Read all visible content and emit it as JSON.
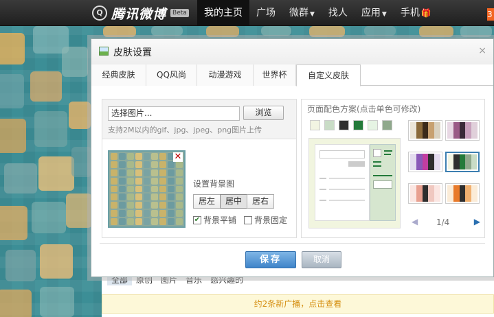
{
  "topbar": {
    "logo_mark": "Q",
    "logo_text": "腾讯微博",
    "beta": "Beta",
    "nav": [
      {
        "label": "我的主页",
        "active": true,
        "caret": false
      },
      {
        "label": "广场",
        "active": false,
        "caret": false
      },
      {
        "label": "微群",
        "active": false,
        "caret": true
      },
      {
        "label": "找人",
        "active": false,
        "caret": false
      },
      {
        "label": "应用",
        "active": false,
        "caret": true
      },
      {
        "label": "手机",
        "active": false,
        "caret": false
      }
    ],
    "badge": "3"
  },
  "feed": {
    "tabs": [
      "全部",
      "原创",
      "图片",
      "音乐",
      "感兴趣的"
    ],
    "new_posts": "约2条新广播，点击查看"
  },
  "dialog": {
    "title": "皮肤设置",
    "close": "×",
    "tabs": [
      "经典皮肤",
      "QQ风尚",
      "动漫游戏",
      "世界杯",
      "自定义皮肤"
    ],
    "active_tab": 4,
    "upload": {
      "file_value": "选择图片...",
      "browse": "浏览",
      "hint": "支持2M以内的gif、jpg、jpeg、png图片上传"
    },
    "preview_close": "✕",
    "bg_label": "设置背景图",
    "positions": [
      "居左",
      "居中",
      "居右"
    ],
    "active_position": 1,
    "tile_label": "背景平铺",
    "tile_checked": true,
    "fixed_label": "背景固定",
    "fixed_checked": false,
    "palette": {
      "title": "页面配色方案(点击单色可修改)",
      "swatches": [
        "#f2f4e2",
        "#c9dcc6",
        "#2e2e2e",
        "#237a3a",
        "#e6f4e4",
        "#8fa88c"
      ],
      "themes": [
        {
          "colors": [
            "#ece6d8",
            "#8a6a3a",
            "#3a2a1a",
            "#c7a070",
            "#d9d1c0"
          ],
          "selected": false
        },
        {
          "colors": [
            "#e8d8e4",
            "#9a5a86",
            "#3a2a38",
            "#c8a0bc",
            "#e0d0da"
          ],
          "selected": false
        },
        {
          "colors": [
            "#e4dcef",
            "#8a58b8",
            "#c23ea0",
            "#2e2e2e",
            "#e4dcef"
          ],
          "selected": false
        },
        {
          "colors": [
            "#f2f4e2",
            "#2e2e2e",
            "#237a3a",
            "#8fa88c",
            "#c9dcc6"
          ],
          "selected": true
        },
        {
          "colors": [
            "#fbe6e2",
            "#e8a090",
            "#2e2e2e",
            "#f0c8c0",
            "#fbe6e2"
          ],
          "selected": false
        },
        {
          "colors": [
            "#fbecd8",
            "#e87a2a",
            "#2e2e2e",
            "#f0b070",
            "#fbecd8"
          ],
          "selected": false
        }
      ],
      "page": "1/4",
      "prev": "◀",
      "next": "▶"
    },
    "save": "保存",
    "cancel": "取消"
  },
  "colors": {
    "accent": "#3f84c9",
    "background": "#3c8e96"
  }
}
